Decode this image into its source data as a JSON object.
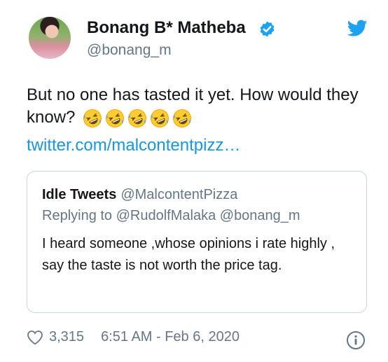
{
  "author": {
    "name": "Bonang B* Matheba",
    "handle": "@bonang_m",
    "verified_icon": "verified-badge-icon",
    "verified_color": "#1da1f2"
  },
  "platform_icon": "twitter-bird-icon",
  "tweet": {
    "text": "But no one has tasted it yet. How would they know?",
    "emoji": "rolling-on-the-floor-laughing",
    "emoji_count": 5,
    "link": "twitter.com/malcontentpizz…",
    "link_color": "#1b95e0"
  },
  "quoted_tweet": {
    "name": "Idle Tweets",
    "handle": "@MalcontentPizza",
    "reply_line": "Replying to @RudolfMalaka @bonang_m",
    "text": "I heard someone ,whose opinions i rate highly , say the taste is not worth the price tag."
  },
  "footer": {
    "like_icon": "heart-icon",
    "likes": "3,315",
    "timestamp": "6:51 AM - Feb 6, 2020",
    "info_icon": "info-icon"
  },
  "colors": {
    "text": "#14171a",
    "secondary": "#657786",
    "border": "#ccd6dd"
  }
}
